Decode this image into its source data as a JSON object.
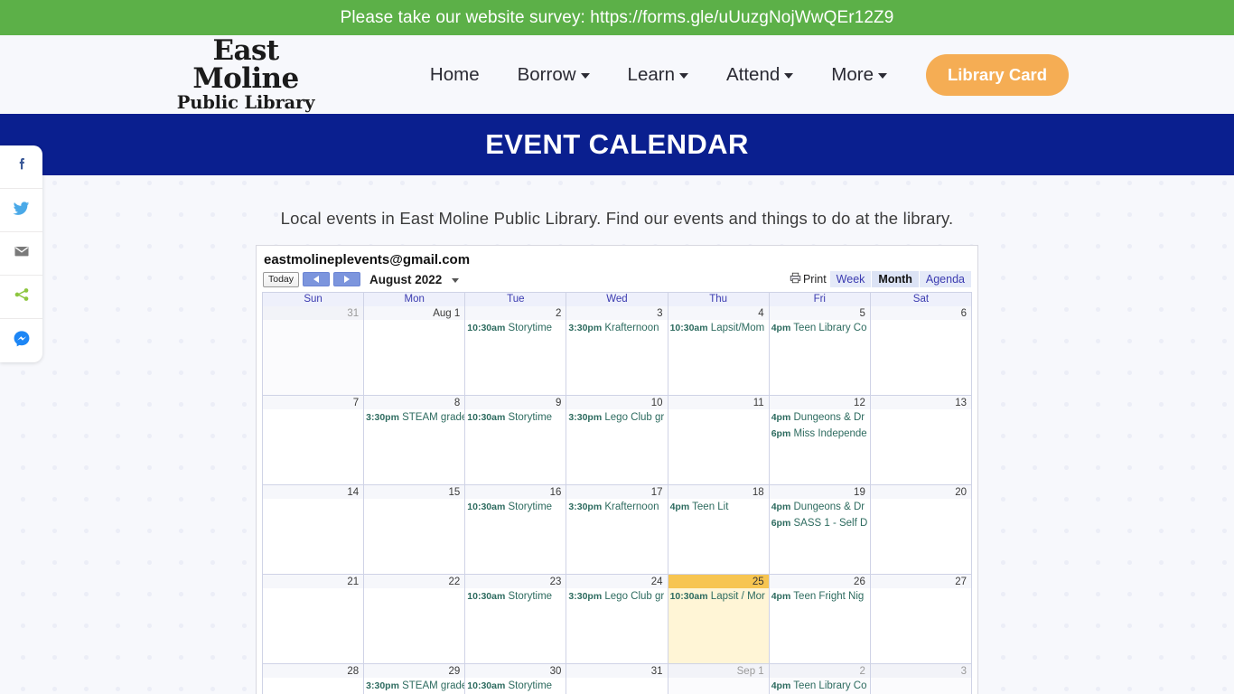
{
  "survey_banner": {
    "text": "Please take our website survey: https://forms.gle/uUuzgNojWwQEr12Z9"
  },
  "header": {
    "logo_line1": "East Moline",
    "logo_line2": "Public Library",
    "nav": [
      {
        "label": "Home",
        "has_caret": false
      },
      {
        "label": "Borrow",
        "has_caret": true
      },
      {
        "label": "Learn",
        "has_caret": true
      },
      {
        "label": "Attend",
        "has_caret": true
      },
      {
        "label": "More",
        "has_caret": true
      }
    ],
    "library_card_label": "Library Card",
    "accent_color": "#f5ad54"
  },
  "page_title": "EVENT CALENDAR",
  "title_band_color": "#0a1f8f",
  "social_rail": [
    {
      "name": "facebook-icon",
      "color": "#3b5998"
    },
    {
      "name": "twitter-icon",
      "color": "#4aa9e8"
    },
    {
      "name": "email-icon",
      "color": "#7a7a7a"
    },
    {
      "name": "share-icon",
      "color": "#8dc63f"
    },
    {
      "name": "messenger-icon",
      "color": "#1d86f5"
    }
  ],
  "intro_text": "Local events in East Moline Public Library. Find our events and things to do at the library.",
  "calendar": {
    "account": "eastmolineplevents@gmail.com",
    "today_label": "Today",
    "month_label": "August 2022",
    "print_label": "Print",
    "views": [
      {
        "label": "Week",
        "active": false
      },
      {
        "label": "Month",
        "active": true
      },
      {
        "label": "Agenda",
        "active": false
      }
    ],
    "day_headers": [
      "Sun",
      "Mon",
      "Tue",
      "Wed",
      "Thu",
      "Fri",
      "Sat"
    ],
    "weeks": [
      [
        {
          "num": "31",
          "other": true,
          "today": false,
          "events": []
        },
        {
          "num": "Aug 1",
          "other": false,
          "today": false,
          "events": []
        },
        {
          "num": "2",
          "other": false,
          "today": false,
          "events": [
            {
              "time": "10:30am",
              "title": "Storytime"
            }
          ]
        },
        {
          "num": "3",
          "other": false,
          "today": false,
          "events": [
            {
              "time": "3:30pm",
              "title": "Krafternoon"
            }
          ]
        },
        {
          "num": "4",
          "other": false,
          "today": false,
          "events": [
            {
              "time": "10:30am",
              "title": "Lapsit/Mom"
            }
          ]
        },
        {
          "num": "5",
          "other": false,
          "today": false,
          "events": [
            {
              "time": "4pm",
              "title": "Teen Library Co"
            }
          ]
        },
        {
          "num": "6",
          "other": false,
          "today": false,
          "events": []
        }
      ],
      [
        {
          "num": "7",
          "other": false,
          "today": false,
          "events": []
        },
        {
          "num": "8",
          "other": false,
          "today": false,
          "events": [
            {
              "time": "3:30pm",
              "title": "STEAM grade"
            }
          ]
        },
        {
          "num": "9",
          "other": false,
          "today": false,
          "events": [
            {
              "time": "10:30am",
              "title": "Storytime"
            }
          ]
        },
        {
          "num": "10",
          "other": false,
          "today": false,
          "events": [
            {
              "time": "3:30pm",
              "title": "Lego Club gr"
            }
          ]
        },
        {
          "num": "11",
          "other": false,
          "today": false,
          "events": []
        },
        {
          "num": "12",
          "other": false,
          "today": false,
          "events": [
            {
              "time": "4pm",
              "title": "Dungeons & Dr"
            },
            {
              "time": "6pm",
              "title": "Miss Independe"
            }
          ]
        },
        {
          "num": "13",
          "other": false,
          "today": false,
          "events": []
        }
      ],
      [
        {
          "num": "14",
          "other": false,
          "today": false,
          "events": []
        },
        {
          "num": "15",
          "other": false,
          "today": false,
          "events": []
        },
        {
          "num": "16",
          "other": false,
          "today": false,
          "events": [
            {
              "time": "10:30am",
              "title": "Storytime"
            }
          ]
        },
        {
          "num": "17",
          "other": false,
          "today": false,
          "events": [
            {
              "time": "3:30pm",
              "title": "Krafternoon"
            }
          ]
        },
        {
          "num": "18",
          "other": false,
          "today": false,
          "events": [
            {
              "time": "4pm",
              "title": "Teen Lit"
            }
          ]
        },
        {
          "num": "19",
          "other": false,
          "today": false,
          "events": [
            {
              "time": "4pm",
              "title": "Dungeons & Dr"
            },
            {
              "time": "6pm",
              "title": "SASS 1 - Self D"
            }
          ]
        },
        {
          "num": "20",
          "other": false,
          "today": false,
          "events": []
        }
      ],
      [
        {
          "num": "21",
          "other": false,
          "today": false,
          "events": []
        },
        {
          "num": "22",
          "other": false,
          "today": false,
          "events": []
        },
        {
          "num": "23",
          "other": false,
          "today": false,
          "events": [
            {
              "time": "10:30am",
              "title": "Storytime"
            }
          ]
        },
        {
          "num": "24",
          "other": false,
          "today": false,
          "events": [
            {
              "time": "3:30pm",
              "title": "Lego Club gr"
            }
          ]
        },
        {
          "num": "25",
          "other": false,
          "today": true,
          "events": [
            {
              "time": "10:30am",
              "title": "Lapsit / Mor"
            }
          ]
        },
        {
          "num": "26",
          "other": false,
          "today": false,
          "events": [
            {
              "time": "4pm",
              "title": "Teen Fright Nig"
            }
          ]
        },
        {
          "num": "27",
          "other": false,
          "today": false,
          "events": []
        }
      ],
      [
        {
          "num": "28",
          "other": false,
          "today": false,
          "events": []
        },
        {
          "num": "29",
          "other": false,
          "today": false,
          "events": [
            {
              "time": "3:30pm",
              "title": "STEAM grade"
            }
          ]
        },
        {
          "num": "30",
          "other": false,
          "today": false,
          "events": [
            {
              "time": "10:30am",
              "title": "Storytime"
            }
          ]
        },
        {
          "num": "31",
          "other": false,
          "today": false,
          "events": []
        },
        {
          "num": "Sep 1",
          "other": true,
          "today": false,
          "events": []
        },
        {
          "num": "2",
          "other": true,
          "today": false,
          "events": [
            {
              "time": "4pm",
              "title": "Teen Library Co"
            }
          ]
        },
        {
          "num": "3",
          "other": true,
          "today": false,
          "events": []
        }
      ]
    ]
  }
}
